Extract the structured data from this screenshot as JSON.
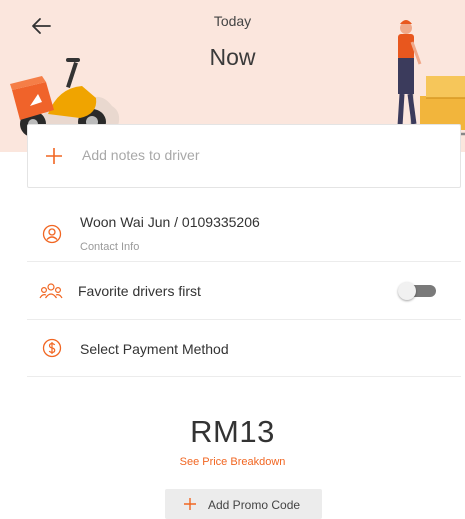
{
  "header": {
    "day_label": "Today",
    "time_label": "Now"
  },
  "notes": {
    "placeholder": "Add notes to driver"
  },
  "contact": {
    "name_phone": "Woon Wai Jun / 0109335206",
    "sublabel": "Contact Info"
  },
  "favorite": {
    "label": "Favorite drivers first",
    "enabled": false
  },
  "payment": {
    "label": "Select Payment Method"
  },
  "price": {
    "amount": "RM13",
    "breakdown_link": "See Price Breakdown"
  },
  "promo": {
    "label": "Add Promo Code"
  },
  "icons": {
    "back": "arrow-left-icon",
    "notes": "plus-icon",
    "contact": "user-circle-icon",
    "favorite": "people-group-icon",
    "payment": "dollar-circle-icon",
    "promo": "plus-icon"
  },
  "colors": {
    "accent": "#f16622",
    "hero_background": "#fbe6dd",
    "toggle_off": "#7a7a7a"
  }
}
